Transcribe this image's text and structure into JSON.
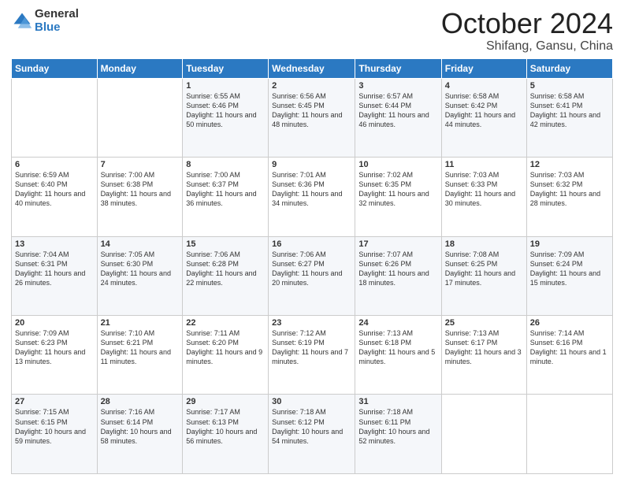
{
  "logo": {
    "general": "General",
    "blue": "Blue"
  },
  "header": {
    "month": "October 2024",
    "location": "Shifang, Gansu, China"
  },
  "weekdays": [
    "Sunday",
    "Monday",
    "Tuesday",
    "Wednesday",
    "Thursday",
    "Friday",
    "Saturday"
  ],
  "weeks": [
    [
      {
        "day": "",
        "sunrise": "",
        "sunset": "",
        "daylight": ""
      },
      {
        "day": "",
        "sunrise": "",
        "sunset": "",
        "daylight": ""
      },
      {
        "day": "1",
        "sunrise": "Sunrise: 6:55 AM",
        "sunset": "Sunset: 6:46 PM",
        "daylight": "Daylight: 11 hours and 50 minutes."
      },
      {
        "day": "2",
        "sunrise": "Sunrise: 6:56 AM",
        "sunset": "Sunset: 6:45 PM",
        "daylight": "Daylight: 11 hours and 48 minutes."
      },
      {
        "day": "3",
        "sunrise": "Sunrise: 6:57 AM",
        "sunset": "Sunset: 6:44 PM",
        "daylight": "Daylight: 11 hours and 46 minutes."
      },
      {
        "day": "4",
        "sunrise": "Sunrise: 6:58 AM",
        "sunset": "Sunset: 6:42 PM",
        "daylight": "Daylight: 11 hours and 44 minutes."
      },
      {
        "day": "5",
        "sunrise": "Sunrise: 6:58 AM",
        "sunset": "Sunset: 6:41 PM",
        "daylight": "Daylight: 11 hours and 42 minutes."
      }
    ],
    [
      {
        "day": "6",
        "sunrise": "Sunrise: 6:59 AM",
        "sunset": "Sunset: 6:40 PM",
        "daylight": "Daylight: 11 hours and 40 minutes."
      },
      {
        "day": "7",
        "sunrise": "Sunrise: 7:00 AM",
        "sunset": "Sunset: 6:38 PM",
        "daylight": "Daylight: 11 hours and 38 minutes."
      },
      {
        "day": "8",
        "sunrise": "Sunrise: 7:00 AM",
        "sunset": "Sunset: 6:37 PM",
        "daylight": "Daylight: 11 hours and 36 minutes."
      },
      {
        "day": "9",
        "sunrise": "Sunrise: 7:01 AM",
        "sunset": "Sunset: 6:36 PM",
        "daylight": "Daylight: 11 hours and 34 minutes."
      },
      {
        "day": "10",
        "sunrise": "Sunrise: 7:02 AM",
        "sunset": "Sunset: 6:35 PM",
        "daylight": "Daylight: 11 hours and 32 minutes."
      },
      {
        "day": "11",
        "sunrise": "Sunrise: 7:03 AM",
        "sunset": "Sunset: 6:33 PM",
        "daylight": "Daylight: 11 hours and 30 minutes."
      },
      {
        "day": "12",
        "sunrise": "Sunrise: 7:03 AM",
        "sunset": "Sunset: 6:32 PM",
        "daylight": "Daylight: 11 hours and 28 minutes."
      }
    ],
    [
      {
        "day": "13",
        "sunrise": "Sunrise: 7:04 AM",
        "sunset": "Sunset: 6:31 PM",
        "daylight": "Daylight: 11 hours and 26 minutes."
      },
      {
        "day": "14",
        "sunrise": "Sunrise: 7:05 AM",
        "sunset": "Sunset: 6:30 PM",
        "daylight": "Daylight: 11 hours and 24 minutes."
      },
      {
        "day": "15",
        "sunrise": "Sunrise: 7:06 AM",
        "sunset": "Sunset: 6:28 PM",
        "daylight": "Daylight: 11 hours and 22 minutes."
      },
      {
        "day": "16",
        "sunrise": "Sunrise: 7:06 AM",
        "sunset": "Sunset: 6:27 PM",
        "daylight": "Daylight: 11 hours and 20 minutes."
      },
      {
        "day": "17",
        "sunrise": "Sunrise: 7:07 AM",
        "sunset": "Sunset: 6:26 PM",
        "daylight": "Daylight: 11 hours and 18 minutes."
      },
      {
        "day": "18",
        "sunrise": "Sunrise: 7:08 AM",
        "sunset": "Sunset: 6:25 PM",
        "daylight": "Daylight: 11 hours and 17 minutes."
      },
      {
        "day": "19",
        "sunrise": "Sunrise: 7:09 AM",
        "sunset": "Sunset: 6:24 PM",
        "daylight": "Daylight: 11 hours and 15 minutes."
      }
    ],
    [
      {
        "day": "20",
        "sunrise": "Sunrise: 7:09 AM",
        "sunset": "Sunset: 6:23 PM",
        "daylight": "Daylight: 11 hours and 13 minutes."
      },
      {
        "day": "21",
        "sunrise": "Sunrise: 7:10 AM",
        "sunset": "Sunset: 6:21 PM",
        "daylight": "Daylight: 11 hours and 11 minutes."
      },
      {
        "day": "22",
        "sunrise": "Sunrise: 7:11 AM",
        "sunset": "Sunset: 6:20 PM",
        "daylight": "Daylight: 11 hours and 9 minutes."
      },
      {
        "day": "23",
        "sunrise": "Sunrise: 7:12 AM",
        "sunset": "Sunset: 6:19 PM",
        "daylight": "Daylight: 11 hours and 7 minutes."
      },
      {
        "day": "24",
        "sunrise": "Sunrise: 7:13 AM",
        "sunset": "Sunset: 6:18 PM",
        "daylight": "Daylight: 11 hours and 5 minutes."
      },
      {
        "day": "25",
        "sunrise": "Sunrise: 7:13 AM",
        "sunset": "Sunset: 6:17 PM",
        "daylight": "Daylight: 11 hours and 3 minutes."
      },
      {
        "day": "26",
        "sunrise": "Sunrise: 7:14 AM",
        "sunset": "Sunset: 6:16 PM",
        "daylight": "Daylight: 11 hours and 1 minute."
      }
    ],
    [
      {
        "day": "27",
        "sunrise": "Sunrise: 7:15 AM",
        "sunset": "Sunset: 6:15 PM",
        "daylight": "Daylight: 10 hours and 59 minutes."
      },
      {
        "day": "28",
        "sunrise": "Sunrise: 7:16 AM",
        "sunset": "Sunset: 6:14 PM",
        "daylight": "Daylight: 10 hours and 58 minutes."
      },
      {
        "day": "29",
        "sunrise": "Sunrise: 7:17 AM",
        "sunset": "Sunset: 6:13 PM",
        "daylight": "Daylight: 10 hours and 56 minutes."
      },
      {
        "day": "30",
        "sunrise": "Sunrise: 7:18 AM",
        "sunset": "Sunset: 6:12 PM",
        "daylight": "Daylight: 10 hours and 54 minutes."
      },
      {
        "day": "31",
        "sunrise": "Sunrise: 7:18 AM",
        "sunset": "Sunset: 6:11 PM",
        "daylight": "Daylight: 10 hours and 52 minutes."
      },
      {
        "day": "",
        "sunrise": "",
        "sunset": "",
        "daylight": ""
      },
      {
        "day": "",
        "sunrise": "",
        "sunset": "",
        "daylight": ""
      }
    ]
  ]
}
